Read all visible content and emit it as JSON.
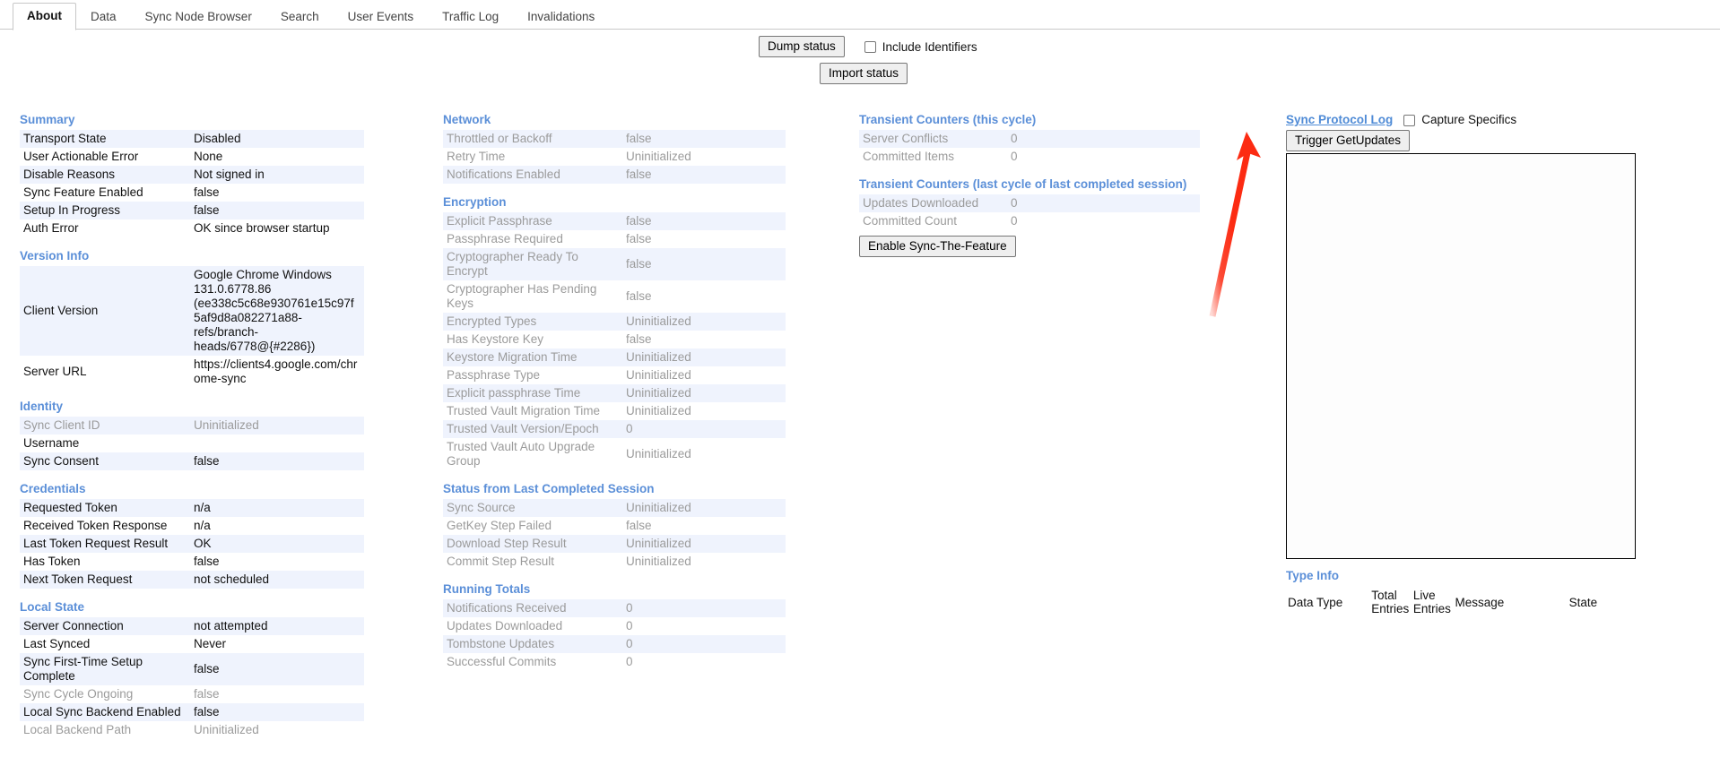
{
  "tabs": [
    {
      "label": "About",
      "active": true
    },
    {
      "label": "Data",
      "active": false
    },
    {
      "label": "Sync Node Browser",
      "active": false
    },
    {
      "label": "Search",
      "active": false
    },
    {
      "label": "User Events",
      "active": false
    },
    {
      "label": "Traffic Log",
      "active": false
    },
    {
      "label": "Invalidations",
      "active": false
    }
  ],
  "actions": {
    "dump_status": "Dump status",
    "include_identifiers": "Include Identifiers",
    "import_status": "Import status"
  },
  "colors": {
    "section_heading": "#5b8fd8",
    "row_stripe": "#eff3fd",
    "dim_text": "#9b9b9b",
    "annotation_arrow": "#fc2b12",
    "link": "#4f8bd6"
  },
  "sections": {
    "summary": {
      "title": "Summary",
      "rows": [
        {
          "key": "Transport State",
          "value": "Disabled",
          "dim": false
        },
        {
          "key": "User Actionable Error",
          "value": "None",
          "dim": false
        },
        {
          "key": "Disable Reasons",
          "value": "Not signed in",
          "dim": false
        },
        {
          "key": "Sync Feature Enabled",
          "value": "false",
          "dim": false
        },
        {
          "key": "Setup In Progress",
          "value": "false",
          "dim": false
        },
        {
          "key": "Auth Error",
          "value": "OK since browser startup",
          "dim": false
        }
      ]
    },
    "version_info": {
      "title": "Version Info",
      "rows": [
        {
          "key": "Client Version",
          "value": "Google Chrome Windows 131.0.6778.86 (ee338c5c68e930761e15c97f5af9d8a082271a88-refs/branch-heads/6778@{#2286})",
          "dim": false
        },
        {
          "key": "Server URL",
          "value": "https://clients4.google.com/chrome-sync",
          "dim": false
        }
      ]
    },
    "identity": {
      "title": "Identity",
      "rows": [
        {
          "key": "Sync Client ID",
          "value": "Uninitialized",
          "dim": true
        },
        {
          "key": "Username",
          "value": "",
          "dim": false
        },
        {
          "key": "Sync Consent",
          "value": "false",
          "dim": false
        }
      ]
    },
    "credentials": {
      "title": "Credentials",
      "rows": [
        {
          "key": "Requested Token",
          "value": "n/a",
          "dim": false
        },
        {
          "key": "Received Token Response",
          "value": "n/a",
          "dim": false
        },
        {
          "key": "Last Token Request Result",
          "value": "OK",
          "dim": false
        },
        {
          "key": "Has Token",
          "value": "false",
          "dim": false
        },
        {
          "key": "Next Token Request",
          "value": "not scheduled",
          "dim": false
        }
      ]
    },
    "local_state": {
      "title": "Local State",
      "rows": [
        {
          "key": "Server Connection",
          "value": "not attempted",
          "dim": false
        },
        {
          "key": "Last Synced",
          "value": "Never",
          "dim": false
        },
        {
          "key": "Sync First-Time Setup Complete",
          "value": "false",
          "dim": false
        },
        {
          "key": "Sync Cycle Ongoing",
          "value": "false",
          "dim": true
        },
        {
          "key": "Local Sync Backend Enabled",
          "value": "false",
          "dim": false
        },
        {
          "key": "Local Backend Path",
          "value": "Uninitialized",
          "dim": true
        }
      ]
    },
    "network": {
      "title": "Network",
      "rows": [
        {
          "key": "Throttled or Backoff",
          "value": "false",
          "dim": true
        },
        {
          "key": "Retry Time",
          "value": "Uninitialized",
          "dim": true
        },
        {
          "key": "Notifications Enabled",
          "value": "false",
          "dim": true
        }
      ]
    },
    "encryption": {
      "title": "Encryption",
      "rows": [
        {
          "key": "Explicit Passphrase",
          "value": "false",
          "dim": true
        },
        {
          "key": "Passphrase Required",
          "value": "false",
          "dim": true
        },
        {
          "key": "Cryptographer Ready To Encrypt",
          "value": "false",
          "dim": true
        },
        {
          "key": "Cryptographer Has Pending Keys",
          "value": "false",
          "dim": true
        },
        {
          "key": "Encrypted Types",
          "value": "Uninitialized",
          "dim": true
        },
        {
          "key": "Has Keystore Key",
          "value": "false",
          "dim": true
        },
        {
          "key": "Keystore Migration Time",
          "value": "Uninitialized",
          "dim": true
        },
        {
          "key": "Passphrase Type",
          "value": "Uninitialized",
          "dim": true
        },
        {
          "key": "Explicit passphrase Time",
          "value": "Uninitialized",
          "dim": true
        },
        {
          "key": "Trusted Vault Migration Time",
          "value": "Uninitialized",
          "dim": true
        },
        {
          "key": "Trusted Vault Version/Epoch",
          "value": "0",
          "dim": true
        },
        {
          "key": "Trusted Vault Auto Upgrade Group",
          "value": "Uninitialized",
          "dim": true
        }
      ]
    },
    "last_session": {
      "title": "Status from Last Completed Session",
      "rows": [
        {
          "key": "Sync Source",
          "value": "Uninitialized",
          "dim": true
        },
        {
          "key": "GetKey Step Failed",
          "value": "false",
          "dim": true
        },
        {
          "key": "Download Step Result",
          "value": "Uninitialized",
          "dim": true
        },
        {
          "key": "Commit Step Result",
          "value": "Uninitialized",
          "dim": true
        }
      ]
    },
    "running_totals": {
      "title": "Running Totals",
      "rows": [
        {
          "key": "Notifications Received",
          "value": "0",
          "dim": true
        },
        {
          "key": "Updates Downloaded",
          "value": "0",
          "dim": true
        },
        {
          "key": "Tombstone Updates",
          "value": "0",
          "dim": true
        },
        {
          "key": "Successful Commits",
          "value": "0",
          "dim": true
        }
      ]
    },
    "transient_this_cycle": {
      "title": "Transient Counters (this cycle)",
      "rows": [
        {
          "key": "Server Conflicts",
          "value": "0",
          "dim": true
        },
        {
          "key": "Committed Items",
          "value": "0",
          "dim": true
        }
      ]
    },
    "transient_last_cycle": {
      "title": "Transient Counters (last cycle of last completed session)",
      "rows": [
        {
          "key": "Updates Downloaded",
          "value": "0",
          "dim": true
        },
        {
          "key": "Committed Count",
          "value": "0",
          "dim": true
        }
      ],
      "enable_button": "Enable Sync-The-Feature"
    },
    "protocol_log": {
      "title": "Sync Protocol Log",
      "capture_specifics": "Capture Specifics",
      "trigger_button": "Trigger GetUpdates",
      "log_content": ""
    },
    "type_info": {
      "title": "Type Info",
      "columns": [
        "Data Type",
        "Total Entries",
        "Live Entries",
        "Message",
        "State"
      ],
      "rows": []
    }
  }
}
